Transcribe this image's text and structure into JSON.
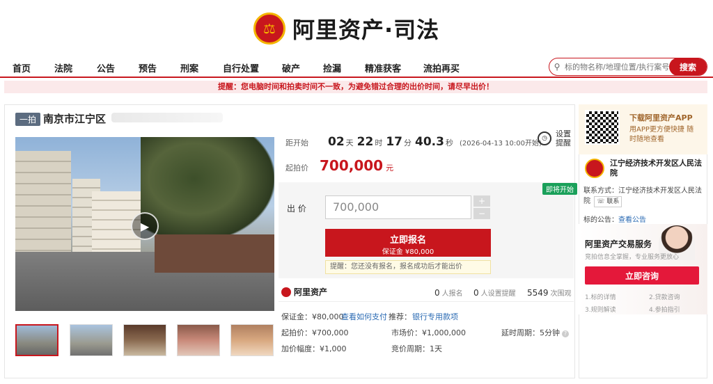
{
  "brand": {
    "name": "阿里资产·司法",
    "mini": "阿里资产"
  },
  "nav": {
    "items": [
      "首页",
      "法院",
      "公告",
      "预告",
      "刑案",
      "自行处置",
      "破产",
      "捡漏",
      "精准获客",
      "流拍再买"
    ],
    "search_placeholder": "标的物名称/地理位置/执行案号",
    "search_button": "搜索"
  },
  "reminder": "提醒：您电脑时间和拍卖时间不一致，为避免错过合理的出价时间，请尽早出价！",
  "lot": {
    "tag": "一拍",
    "title": "南京市江宁区"
  },
  "countdown": {
    "label": "距开始",
    "days": "02",
    "days_unit": "天",
    "hours": "22",
    "hours_unit": "时",
    "minutes": "17",
    "minutes_unit": "分",
    "seconds": "40.3",
    "seconds_unit": "秒",
    "start_time": "(2026-04-13 10:00开始)"
  },
  "set_reminder": "设置提醒",
  "start_price": {
    "label": "起拍价",
    "value": "700,000",
    "unit": "元"
  },
  "bid": {
    "badge": "即将开始",
    "label": "出 价",
    "value": "700,000",
    "plus": "+",
    "minus": "−",
    "register_label": "立即报名",
    "deposit_line": "保证金 ¥80,000",
    "tip": "提醒：您还没有报名，报名成功后才能出价"
  },
  "stats": {
    "signups": "0",
    "signups_label": "人报名",
    "reminders": "0",
    "reminders_label": "人设置提醒",
    "views": "5549",
    "views_label": "次围观"
  },
  "details": {
    "deposit": "保证金：¥80,000",
    "how_to_pay": "查看如何支付",
    "recommend": "推荐：",
    "bank_loan": "银行专用款项",
    "start_price": "起拍价：¥700,000",
    "market_price": "市场价：¥1,000,000",
    "delay": "延时周期：5分钟",
    "increment": "加价幅度：¥1,000",
    "cycle": "竞价周期：1天"
  },
  "sidebar": {
    "app_title": "下载阿里资产APP",
    "app_sub": "用APP更方便快捷 随时随地查看",
    "court_name": "江宁经济技术开发区人民法院",
    "contact_label": "联系方式：江宁经济技术开发区人民法院",
    "contact_btn": "联系",
    "announce_label": "标的公告：",
    "announce_link": "查看公告",
    "service_title": "阿里资产交易服务",
    "service_sub": "竞拍信息全掌握，专业服务更放心",
    "consult": "立即咨询",
    "links": [
      "1.标的详情",
      "2.贷款咨询",
      "3.规则解读",
      "4.参拍指引"
    ]
  },
  "colors": {
    "brand_red": "#c8161d",
    "green_badge": "#1aa05a",
    "link_blue": "#2a6ab3"
  }
}
